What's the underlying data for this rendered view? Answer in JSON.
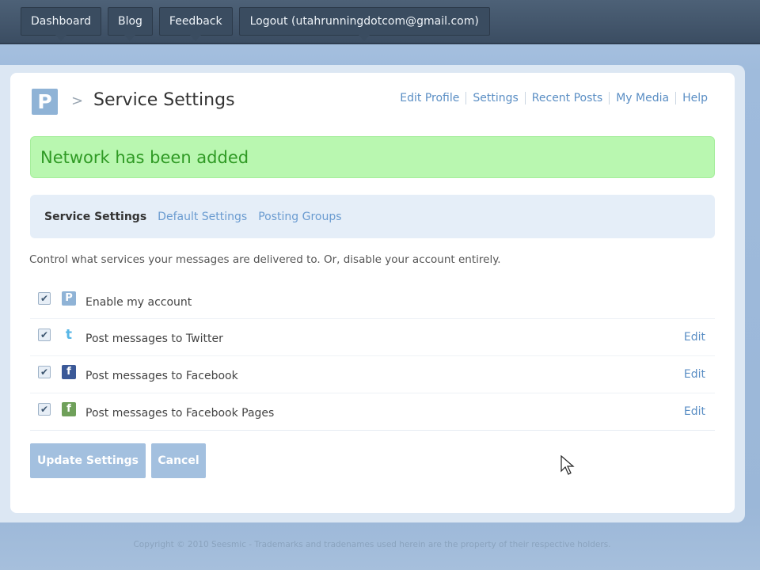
{
  "topnav": {
    "items": [
      "Dashboard",
      "Blog",
      "Feedback",
      "Logout (utahrunningdotcom@gmail.com)"
    ]
  },
  "header": {
    "logo_letter": "P",
    "breadcrumb_separator": ">",
    "title": "Service Settings",
    "links": [
      "Edit Profile",
      "Settings",
      "Recent Posts",
      "My Media",
      "Help"
    ]
  },
  "flash": {
    "message": "Network has been added"
  },
  "tabs": {
    "items": [
      "Service Settings",
      "Default Settings",
      "Posting Groups"
    ],
    "active": "Service Settings"
  },
  "description": "Control what services your messages are delivered to. Or, disable your account entirely.",
  "services": {
    "rows": [
      {
        "label": "Enable my account",
        "icon": "posterous-icon",
        "checked": true,
        "edit": ""
      },
      {
        "label": "Post messages to Twitter",
        "icon": "twitter-icon",
        "checked": true,
        "edit": "Edit"
      },
      {
        "label": "Post messages to Facebook",
        "icon": "facebook-icon",
        "checked": true,
        "edit": "Edit"
      },
      {
        "label": "Post messages to Facebook Pages",
        "icon": "facebook-pages-icon",
        "checked": true,
        "edit": "Edit"
      }
    ]
  },
  "actions": {
    "update_label": "Update Settings",
    "cancel_label": "Cancel"
  },
  "footer": {
    "text": "Copyright © 2010 Seesmic - Trademarks and tradenames used herein are the property of their respective holders."
  },
  "colors": {
    "topbar": "#3b4d62",
    "link": "#5a8ec4",
    "flash_bg": "#b9f7b0",
    "flash_text": "#2f9a24",
    "button_bg": "#a3c0df"
  }
}
